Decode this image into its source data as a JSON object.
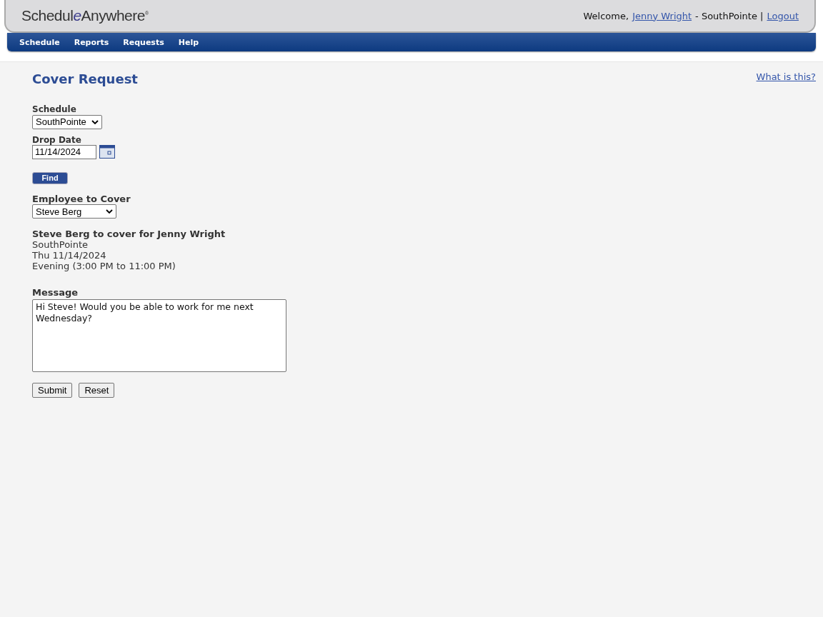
{
  "header": {
    "logo": [
      {
        "text": "Schedul",
        "kind": "plain"
      },
      {
        "text": "e",
        "kind": "italic"
      },
      {
        "text": "Anywhere",
        "kind": "plain"
      },
      {
        "text": "®",
        "kind": "mark"
      }
    ],
    "welcome": "Welcome,",
    "user_link": "Jenny Wright",
    "separator": "- SouthPointe |",
    "logout": "Logout"
  },
  "nav": [
    {
      "label": "Schedule"
    },
    {
      "label": "Reports"
    },
    {
      "label": "Requests"
    },
    {
      "label": "Help"
    }
  ],
  "page": {
    "title": "Cover Request",
    "help_link": "What is this?"
  },
  "form": {
    "schedule": {
      "label": "Schedule",
      "value": "SouthPointe"
    },
    "drop_date": {
      "label": "Drop Date",
      "value": "11/14/2024"
    },
    "find_button": "Find",
    "employee": {
      "label": "Employee to Cover",
      "value": "Steve Berg"
    },
    "summary": {
      "heading": "Steve Berg to cover for Jenny Wright",
      "lines": [
        "SouthPointe",
        "Thu 11/14/2024",
        "Evening (3:00 PM to 11:00 PM)"
      ]
    },
    "message": {
      "label": "Message",
      "value": "Hi Steve! Would you be able to work for me next Wednesday?"
    },
    "buttons": [
      "Submit",
      "Reset"
    ]
  }
}
